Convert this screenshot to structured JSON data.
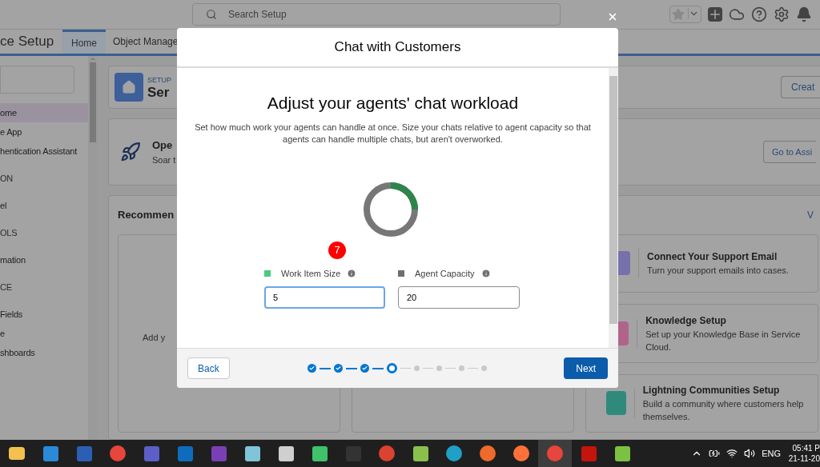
{
  "header": {
    "search": {
      "placeholder": "Search Setup"
    }
  },
  "app_name": "ce Setup",
  "tabs": [
    {
      "label": "Home",
      "selected": true
    },
    {
      "label": "Object Manage",
      "selected": false
    }
  ],
  "sidebar": {
    "items": [
      {
        "label": "ome",
        "kind": "item",
        "selected": true
      },
      {
        "label": "e App",
        "kind": "item",
        "selected": false
      },
      {
        "label": "hentication Assistant",
        "kind": "item",
        "selected": false
      },
      {
        "label": "ON",
        "kind": "section",
        "selected": false
      },
      {
        "label": "el",
        "kind": "item",
        "selected": false
      },
      {
        "label": "OLS",
        "kind": "section",
        "selected": false
      },
      {
        "label": "mation",
        "kind": "item",
        "selected": false
      },
      {
        "label": "CE",
        "kind": "section",
        "selected": false
      },
      {
        "label": "Fields",
        "kind": "item",
        "selected": false
      },
      {
        "label": "e",
        "kind": "item",
        "selected": false
      },
      {
        "label": "shboards",
        "kind": "item",
        "selected": false
      }
    ]
  },
  "setup_card": {
    "eyebrow": "SETUP",
    "title": "Ser",
    "button": "Creat"
  },
  "assistant_card": {
    "title": "Ope",
    "subtitle": "Soar t",
    "button": "Go to Assi"
  },
  "recommended": {
    "title": "Recommen",
    "link": "V",
    "left_card_text": "Add y",
    "items": [
      {
        "title": "Connect Your Support Email",
        "description": "Turn your support emails into cases.",
        "color": "#7471ab"
      },
      {
        "title": "Knowledge Setup",
        "description": "Set up your Knowledge Base in Service Cloud.",
        "color": "#b1648a"
      },
      {
        "title": "Lightning Communities Setup",
        "description": "Build a community where customers help themselves.",
        "color": "#2f8a7c"
      }
    ]
  },
  "modal": {
    "title": "Chat with Customers",
    "heading": "Adjust your agents' chat workload",
    "description": "Set how much work your agents can handle at once. Size your chats relative to agent capacity so that agents can handle multiple chats, but aren't overworked.",
    "fields": [
      {
        "label": "Work Item Size",
        "value": "5",
        "color": "#4bca81",
        "focused": true
      },
      {
        "label": "Agent Capacity",
        "value": "20",
        "color": "#706e6b",
        "focused": false
      }
    ],
    "badge": "7",
    "back": "Back",
    "next": "Next",
    "steps": [
      {
        "kind": "done"
      },
      {
        "kind": "done"
      },
      {
        "kind": "done"
      },
      {
        "kind": "current"
      },
      {
        "kind": "todo"
      },
      {
        "kind": "todo"
      },
      {
        "kind": "todo"
      },
      {
        "kind": "todo"
      }
    ]
  },
  "taskbar": {
    "apps": [
      {
        "selected": false
      },
      {
        "selected": false
      },
      {
        "selected": false
      },
      {
        "selected": false
      },
      {
        "selected": false
      },
      {
        "selected": false
      },
      {
        "selected": false
      },
      {
        "selected": false
      },
      {
        "selected": false
      },
      {
        "selected": false
      },
      {
        "selected": false
      },
      {
        "selected": false
      },
      {
        "selected": false
      },
      {
        "selected": false
      },
      {
        "selected": false
      },
      {
        "selected": false
      },
      {
        "selected": true
      },
      {
        "selected": false
      },
      {
        "selected": false
      }
    ],
    "language": "ENG",
    "time": "05:41 P",
    "date": "21-11-20"
  }
}
